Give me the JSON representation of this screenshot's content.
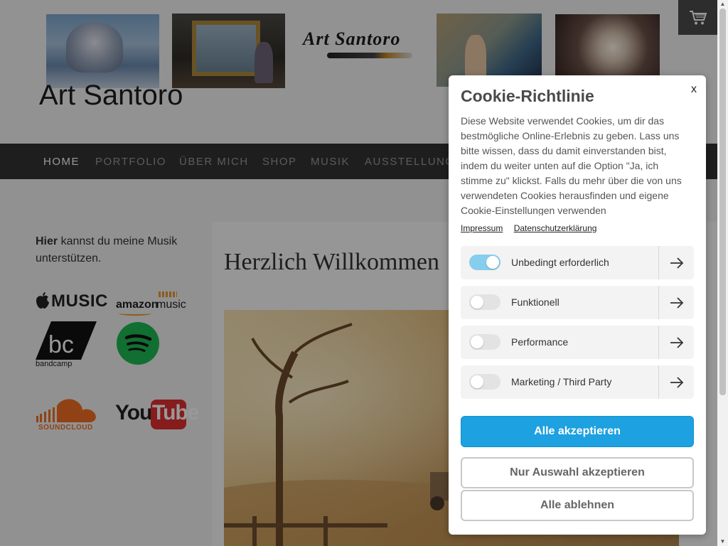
{
  "header": {
    "logo_text": "Art Santoro",
    "site_title": "Art Santoro",
    "cart_icon": "cart-icon"
  },
  "nav": {
    "items": [
      {
        "label": "HOME",
        "active": true
      },
      {
        "label": "PORTFOLIO",
        "active": false
      },
      {
        "label": "ÜBER MICH",
        "active": false
      },
      {
        "label": "SHOP",
        "active": false
      },
      {
        "label": "MUSIK",
        "active": false
      },
      {
        "label": "AUSSTELLUNG",
        "active": false
      }
    ]
  },
  "sidebar": {
    "intro_bold": "Hier",
    "intro_rest": " kannst du meine Musik unterstützen.",
    "logos": {
      "apple": "MUSIC",
      "amazon": "amazon",
      "amazon_suffix": "music",
      "bandcamp": "bandcamp",
      "soundcloud": "SOUNDCLOUD",
      "youtube_you": "You",
      "youtube_tube": "Tube"
    }
  },
  "main": {
    "heading": "Herzlich Willkommen"
  },
  "cookie_modal": {
    "title": "Cookie-Richtlinie",
    "close_label": "x",
    "body": "Diese Website verwendet Cookies, um dir das bestmögliche Online-Erlebnis zu geben. Lass uns bitte wissen, dass du damit einverstanden bist, indem du weiter unten auf die Option \"Ja, ich stimme zu\" klickst. Falls du mehr über die von uns verwendeten Cookies herausfinden und eigene Cookie-Einstellungen verwenden",
    "links": {
      "impressum": "Impressum",
      "privacy": "Datenschutzerklärung"
    },
    "categories": [
      {
        "label": "Unbedingt erforderlich",
        "enabled": true
      },
      {
        "label": "Funktionell",
        "enabled": false
      },
      {
        "label": "Performance",
        "enabled": false
      },
      {
        "label": "Marketing / Third Party",
        "enabled": false
      }
    ],
    "buttons": {
      "accept_all": "Alle akzeptieren",
      "accept_selection": "Nur Auswahl akzeptieren",
      "reject_all": "Alle ablehnen"
    }
  },
  "colors": {
    "accent": "#1da1e0",
    "toggle_on": "#87cdee",
    "nav_bg": "#333333",
    "spotify": "#1db954",
    "youtube": "#e02f2f",
    "soundcloud": "#f26f23"
  }
}
